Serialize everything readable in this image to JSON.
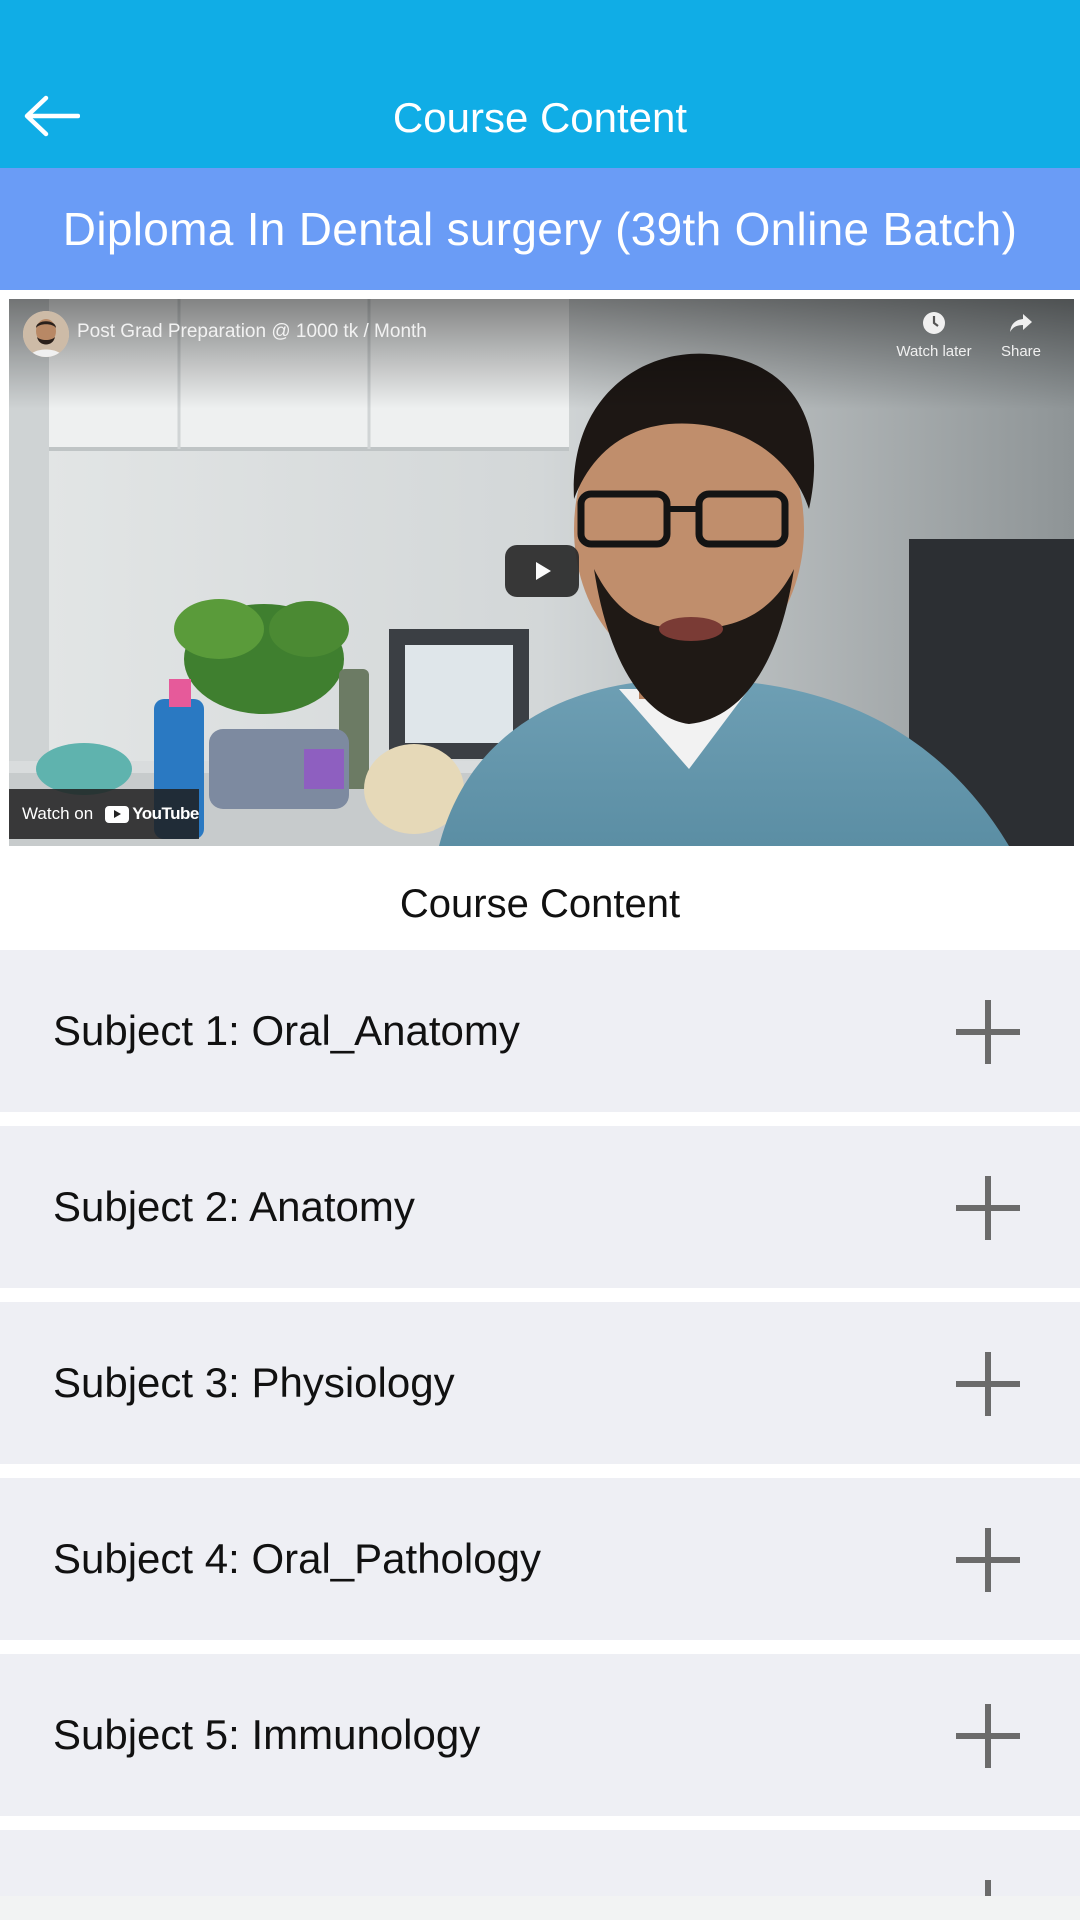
{
  "appbar": {
    "title": "Course Content",
    "back_icon": "arrow-left-icon"
  },
  "course": {
    "name": "Diploma In Dental surgery  (39th Online Batch)"
  },
  "video": {
    "title": "Post Grad Preparation @ 1000 tk / Month",
    "watch_later_label": "Watch later",
    "share_label": "Share",
    "watch_on_label": "Watch on",
    "youtube_label": "YouTube",
    "icons": [
      "clock-icon",
      "share-icon",
      "play-icon",
      "youtube-logo-icon"
    ]
  },
  "section": {
    "heading": "Course Content"
  },
  "subjects": [
    {
      "label": "Subject 1: Oral_Anatomy"
    },
    {
      "label": "Subject 2: Anatomy"
    },
    {
      "label": "Subject 3: Physiology"
    },
    {
      "label": "Subject 4: Oral_Pathology"
    },
    {
      "label": "Subject 5: Immunology"
    },
    {
      "label": ""
    }
  ],
  "colors": {
    "appbar": "#10ade6",
    "banner": "#6a9cf6",
    "list_item_bg": "#eeeff4",
    "plus_icon": "#6b6b6b"
  }
}
